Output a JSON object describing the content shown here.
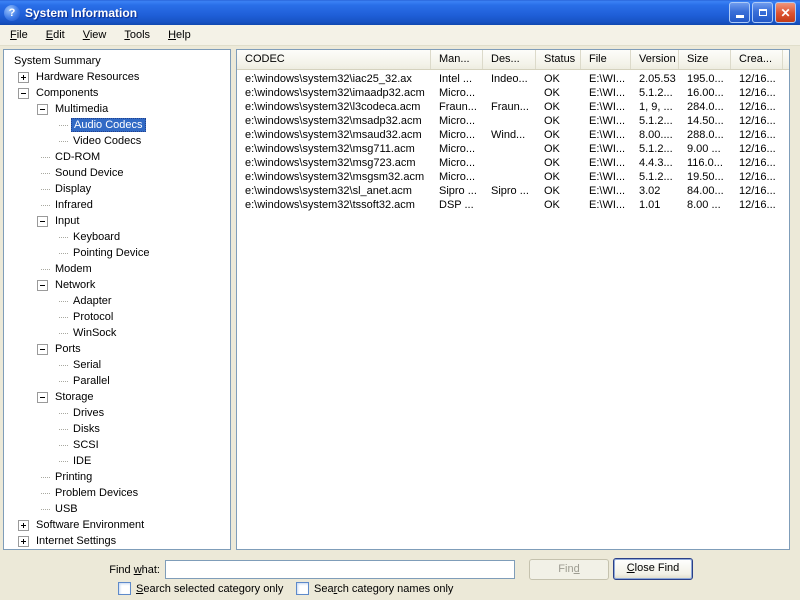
{
  "window": {
    "title": "System Information",
    "icon": "system-information-question-mark-icon"
  },
  "titlebar": {
    "buttons": [
      "minimize-icon",
      "restore-icon",
      "close-icon"
    ]
  },
  "menu": {
    "items": [
      {
        "pre": "",
        "key": "F",
        "post": "ile"
      },
      {
        "pre": "",
        "key": "E",
        "post": "dit"
      },
      {
        "pre": "",
        "key": "V",
        "post": "iew"
      },
      {
        "pre": "",
        "key": "T",
        "post": "ools"
      },
      {
        "pre": "",
        "key": "H",
        "post": "elp"
      }
    ]
  },
  "tree": {
    "items": [
      {
        "label": "System Summary",
        "level": 0,
        "expander": null,
        "selected": false
      },
      {
        "label": "Hardware Resources",
        "level": 1,
        "expander": "plus",
        "selected": false
      },
      {
        "label": "Components",
        "level": 1,
        "expander": "minus",
        "selected": false
      },
      {
        "label": "Multimedia",
        "level": 2,
        "expander": "minus",
        "selected": false
      },
      {
        "label": "Audio Codecs",
        "level": 3,
        "expander": null,
        "selected": true
      },
      {
        "label": "Video Codecs",
        "level": 3,
        "expander": null,
        "selected": false
      },
      {
        "label": "CD-ROM",
        "level": 2,
        "expander": null,
        "selected": false
      },
      {
        "label": "Sound Device",
        "level": 2,
        "expander": null,
        "selected": false
      },
      {
        "label": "Display",
        "level": 2,
        "expander": null,
        "selected": false
      },
      {
        "label": "Infrared",
        "level": 2,
        "expander": null,
        "selected": false
      },
      {
        "label": "Input",
        "level": 2,
        "expander": "minus",
        "selected": false
      },
      {
        "label": "Keyboard",
        "level": 3,
        "expander": null,
        "selected": false
      },
      {
        "label": "Pointing Device",
        "level": 3,
        "expander": null,
        "selected": false
      },
      {
        "label": "Modem",
        "level": 2,
        "expander": null,
        "selected": false
      },
      {
        "label": "Network",
        "level": 2,
        "expander": "minus",
        "selected": false
      },
      {
        "label": "Adapter",
        "level": 3,
        "expander": null,
        "selected": false
      },
      {
        "label": "Protocol",
        "level": 3,
        "expander": null,
        "selected": false
      },
      {
        "label": "WinSock",
        "level": 3,
        "expander": null,
        "selected": false
      },
      {
        "label": "Ports",
        "level": 2,
        "expander": "minus",
        "selected": false
      },
      {
        "label": "Serial",
        "level": 3,
        "expander": null,
        "selected": false
      },
      {
        "label": "Parallel",
        "level": 3,
        "expander": null,
        "selected": false
      },
      {
        "label": "Storage",
        "level": 2,
        "expander": "minus",
        "selected": false
      },
      {
        "label": "Drives",
        "level": 3,
        "expander": null,
        "selected": false
      },
      {
        "label": "Disks",
        "level": 3,
        "expander": null,
        "selected": false
      },
      {
        "label": "SCSI",
        "level": 3,
        "expander": null,
        "selected": false
      },
      {
        "label": "IDE",
        "level": 3,
        "expander": null,
        "selected": false
      },
      {
        "label": "Printing",
        "level": 2,
        "expander": null,
        "selected": false
      },
      {
        "label": "Problem Devices",
        "level": 2,
        "expander": null,
        "selected": false
      },
      {
        "label": "USB",
        "level": 2,
        "expander": null,
        "selected": false
      },
      {
        "label": "Software Environment",
        "level": 1,
        "expander": "plus",
        "selected": false
      },
      {
        "label": "Internet Settings",
        "level": 1,
        "expander": "plus",
        "selected": false
      }
    ]
  },
  "table": {
    "columns": [
      "CODEC",
      "Man...",
      "Des...",
      "Status",
      "File",
      "Version",
      "Size",
      "Crea..."
    ],
    "rows": [
      [
        "e:\\windows\\system32\\iac25_32.ax",
        "Intel ...",
        "Indeo...",
        "OK",
        "E:\\WI...",
        "2.05.53",
        "195.0...",
        "12/16..."
      ],
      [
        "e:\\windows\\system32\\imaadp32.acm",
        "Micro...",
        "",
        "OK",
        "E:\\WI...",
        "5.1.2...",
        "16.00...",
        "12/16..."
      ],
      [
        "e:\\windows\\system32\\l3codeca.acm",
        "Fraun...",
        "Fraun...",
        "OK",
        "E:\\WI...",
        "1, 9, ...",
        "284.0...",
        "12/16..."
      ],
      [
        "e:\\windows\\system32\\msadp32.acm",
        "Micro...",
        "",
        "OK",
        "E:\\WI...",
        "5.1.2...",
        "14.50...",
        "12/16..."
      ],
      [
        "e:\\windows\\system32\\msaud32.acm",
        "Micro...",
        "Wind...",
        "OK",
        "E:\\WI...",
        "8.00....",
        "288.0...",
        "12/16..."
      ],
      [
        "e:\\windows\\system32\\msg711.acm",
        "Micro...",
        "",
        "OK",
        "E:\\WI...",
        "5.1.2...",
        "9.00 ...",
        "12/16..."
      ],
      [
        "e:\\windows\\system32\\msg723.acm",
        "Micro...",
        "",
        "OK",
        "E:\\WI...",
        "4.4.3...",
        "116.0...",
        "12/16..."
      ],
      [
        "e:\\windows\\system32\\msgsm32.acm",
        "Micro...",
        "",
        "OK",
        "E:\\WI...",
        "5.1.2...",
        "19.50...",
        "12/16..."
      ],
      [
        "e:\\windows\\system32\\sl_anet.acm",
        "Sipro ...",
        "Sipro ...",
        "OK",
        "E:\\WI...",
        "3.02",
        "84.00...",
        "12/16..."
      ],
      [
        "e:\\windows\\system32\\tssoft32.acm",
        "DSP ...",
        "",
        "OK",
        "E:\\WI...",
        "1.01",
        "8.00 ...",
        "12/16..."
      ]
    ]
  },
  "find_bar": {
    "label": {
      "pre": "Find ",
      "key": "w",
      "post": "hat:"
    },
    "input_value": "",
    "find_button": {
      "pre": "Fin",
      "key": "d",
      "post": "",
      "disabled": true
    },
    "close_button": {
      "pre": "",
      "key": "C",
      "post": "lose Find",
      "disabled": false
    },
    "checkbox_selected_category": {
      "pre": "",
      "key": "S",
      "post": "earch selected category only",
      "checked": false
    },
    "checkbox_category_names": {
      "pre": "Sea",
      "key": "r",
      "post": "ch category names only",
      "checked": false
    }
  },
  "colors": {
    "titlebar_blue": "#1F5FD8",
    "selection_blue": "#316AC5",
    "panel_border": "#7F9DB9",
    "client_background": "#ECE9D8",
    "close_button_red": "#DD5230"
  }
}
